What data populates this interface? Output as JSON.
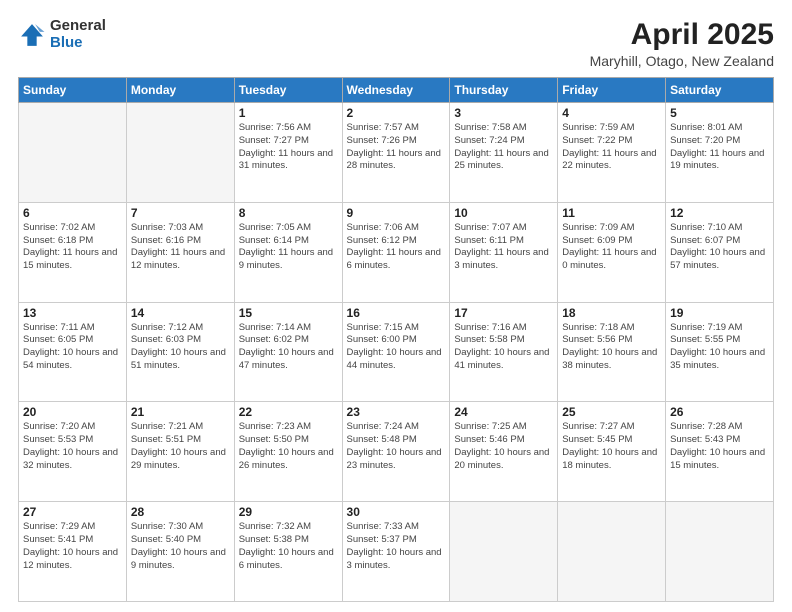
{
  "header": {
    "logo_general": "General",
    "logo_blue": "Blue",
    "main_title": "April 2025",
    "subtitle": "Maryhill, Otago, New Zealand"
  },
  "days_of_week": [
    "Sunday",
    "Monday",
    "Tuesday",
    "Wednesday",
    "Thursday",
    "Friday",
    "Saturday"
  ],
  "weeks": [
    [
      {
        "day": "",
        "info": ""
      },
      {
        "day": "",
        "info": ""
      },
      {
        "day": "1",
        "info": "Sunrise: 7:56 AM\nSunset: 7:27 PM\nDaylight: 11 hours and 31 minutes."
      },
      {
        "day": "2",
        "info": "Sunrise: 7:57 AM\nSunset: 7:26 PM\nDaylight: 11 hours and 28 minutes."
      },
      {
        "day": "3",
        "info": "Sunrise: 7:58 AM\nSunset: 7:24 PM\nDaylight: 11 hours and 25 minutes."
      },
      {
        "day": "4",
        "info": "Sunrise: 7:59 AM\nSunset: 7:22 PM\nDaylight: 11 hours and 22 minutes."
      },
      {
        "day": "5",
        "info": "Sunrise: 8:01 AM\nSunset: 7:20 PM\nDaylight: 11 hours and 19 minutes."
      }
    ],
    [
      {
        "day": "6",
        "info": "Sunrise: 7:02 AM\nSunset: 6:18 PM\nDaylight: 11 hours and 15 minutes."
      },
      {
        "day": "7",
        "info": "Sunrise: 7:03 AM\nSunset: 6:16 PM\nDaylight: 11 hours and 12 minutes."
      },
      {
        "day": "8",
        "info": "Sunrise: 7:05 AM\nSunset: 6:14 PM\nDaylight: 11 hours and 9 minutes."
      },
      {
        "day": "9",
        "info": "Sunrise: 7:06 AM\nSunset: 6:12 PM\nDaylight: 11 hours and 6 minutes."
      },
      {
        "day": "10",
        "info": "Sunrise: 7:07 AM\nSunset: 6:11 PM\nDaylight: 11 hours and 3 minutes."
      },
      {
        "day": "11",
        "info": "Sunrise: 7:09 AM\nSunset: 6:09 PM\nDaylight: 11 hours and 0 minutes."
      },
      {
        "day": "12",
        "info": "Sunrise: 7:10 AM\nSunset: 6:07 PM\nDaylight: 10 hours and 57 minutes."
      }
    ],
    [
      {
        "day": "13",
        "info": "Sunrise: 7:11 AM\nSunset: 6:05 PM\nDaylight: 10 hours and 54 minutes."
      },
      {
        "day": "14",
        "info": "Sunrise: 7:12 AM\nSunset: 6:03 PM\nDaylight: 10 hours and 51 minutes."
      },
      {
        "day": "15",
        "info": "Sunrise: 7:14 AM\nSunset: 6:02 PM\nDaylight: 10 hours and 47 minutes."
      },
      {
        "day": "16",
        "info": "Sunrise: 7:15 AM\nSunset: 6:00 PM\nDaylight: 10 hours and 44 minutes."
      },
      {
        "day": "17",
        "info": "Sunrise: 7:16 AM\nSunset: 5:58 PM\nDaylight: 10 hours and 41 minutes."
      },
      {
        "day": "18",
        "info": "Sunrise: 7:18 AM\nSunset: 5:56 PM\nDaylight: 10 hours and 38 minutes."
      },
      {
        "day": "19",
        "info": "Sunrise: 7:19 AM\nSunset: 5:55 PM\nDaylight: 10 hours and 35 minutes."
      }
    ],
    [
      {
        "day": "20",
        "info": "Sunrise: 7:20 AM\nSunset: 5:53 PM\nDaylight: 10 hours and 32 minutes."
      },
      {
        "day": "21",
        "info": "Sunrise: 7:21 AM\nSunset: 5:51 PM\nDaylight: 10 hours and 29 minutes."
      },
      {
        "day": "22",
        "info": "Sunrise: 7:23 AM\nSunset: 5:50 PM\nDaylight: 10 hours and 26 minutes."
      },
      {
        "day": "23",
        "info": "Sunrise: 7:24 AM\nSunset: 5:48 PM\nDaylight: 10 hours and 23 minutes."
      },
      {
        "day": "24",
        "info": "Sunrise: 7:25 AM\nSunset: 5:46 PM\nDaylight: 10 hours and 20 minutes."
      },
      {
        "day": "25",
        "info": "Sunrise: 7:27 AM\nSunset: 5:45 PM\nDaylight: 10 hours and 18 minutes."
      },
      {
        "day": "26",
        "info": "Sunrise: 7:28 AM\nSunset: 5:43 PM\nDaylight: 10 hours and 15 minutes."
      }
    ],
    [
      {
        "day": "27",
        "info": "Sunrise: 7:29 AM\nSunset: 5:41 PM\nDaylight: 10 hours and 12 minutes."
      },
      {
        "day": "28",
        "info": "Sunrise: 7:30 AM\nSunset: 5:40 PM\nDaylight: 10 hours and 9 minutes."
      },
      {
        "day": "29",
        "info": "Sunrise: 7:32 AM\nSunset: 5:38 PM\nDaylight: 10 hours and 6 minutes."
      },
      {
        "day": "30",
        "info": "Sunrise: 7:33 AM\nSunset: 5:37 PM\nDaylight: 10 hours and 3 minutes."
      },
      {
        "day": "",
        "info": ""
      },
      {
        "day": "",
        "info": ""
      },
      {
        "day": "",
        "info": ""
      }
    ]
  ]
}
